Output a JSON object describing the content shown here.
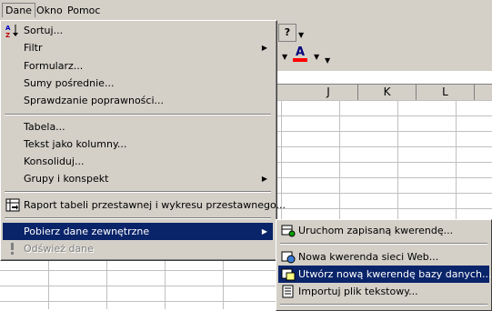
{
  "menubar": {
    "items": [
      {
        "label": "Dane",
        "active": true
      },
      {
        "label": "Okno"
      },
      {
        "label": "Pomoc"
      }
    ]
  },
  "columns": [
    "J",
    "K",
    "L"
  ],
  "toolbar": {
    "help_icon": "help-question-icon",
    "font_color_label": "A",
    "font_color": "#ff0000"
  },
  "menu": {
    "items": [
      {
        "label": "Sortuj...",
        "icon": "sort-az-icon"
      },
      {
        "label": "Filtr",
        "submenu": true
      },
      {
        "label": "Formularz..."
      },
      {
        "label": "Sumy pośrednie..."
      },
      {
        "label": "Sprawdzanie poprawności..."
      },
      {
        "label": "Tabela..."
      },
      {
        "label": "Tekst jako kolumny..."
      },
      {
        "label": "Konsoliduj..."
      },
      {
        "label": "Grupy i konspekt",
        "submenu": true
      },
      {
        "label": "Raport tabeli przestawnej i wykresu przestawnego...",
        "icon": "pivot-table-icon"
      },
      {
        "label": "Pobierz dane zewnętrzne",
        "submenu": true,
        "highlighted": true
      },
      {
        "label": "Odśwież dane",
        "disabled": true,
        "icon": "refresh-exclamation-icon"
      }
    ]
  },
  "submenu": {
    "items": [
      {
        "label": "Uruchom zapisaną kwerendę...",
        "icon": "run-query-icon"
      },
      {
        "label": "Nowa kwerenda sieci Web...",
        "icon": "web-query-icon"
      },
      {
        "label": "Utwórz nową kwerendę bazy danych...",
        "icon": "database-query-icon",
        "highlighted": true
      },
      {
        "label": "Importuj plik tekstowy...",
        "icon": "text-file-icon"
      }
    ]
  },
  "colors": {
    "menu_bg": "#d4d0c8",
    "highlight": "#0a246a",
    "disabled": "#808080"
  }
}
